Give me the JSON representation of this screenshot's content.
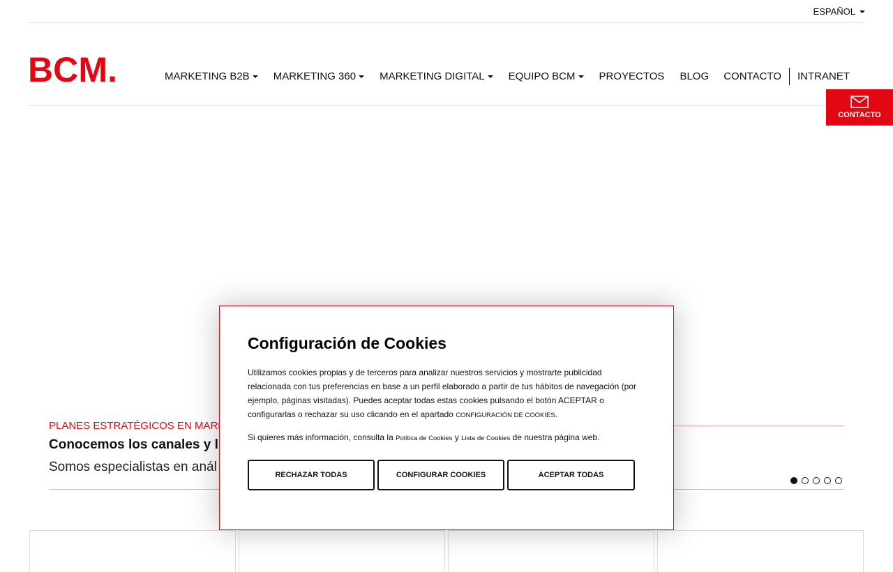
{
  "topbar": {
    "language": "ESPAÑOL"
  },
  "header": {
    "logo_text": "BCM.",
    "nav": [
      {
        "label": "MARKETING B2B",
        "dropdown": true
      },
      {
        "label": "MARKETING 360",
        "dropdown": true
      },
      {
        "label": "MARKETING DIGITAL",
        "dropdown": true
      },
      {
        "label": "EQUIPO BCM",
        "dropdown": true
      },
      {
        "label": "PROYECTOS",
        "dropdown": false
      },
      {
        "label": "BLOG",
        "dropdown": false
      }
    ],
    "right_nav": [
      {
        "label": "CONTACTO"
      },
      {
        "label": "INTRANET"
      }
    ]
  },
  "side_contact": {
    "label": "CONTACTO",
    "icon": "envelope-icon"
  },
  "hero": {
    "label": "PLANES ESTRATÉGICOS EN MARKE",
    "title": "Conocemos los canales y l",
    "subtitle": "Somos especialistas en anál",
    "slides_total": 5,
    "active_slide": 1
  },
  "cookie_modal": {
    "title": "Configuración de Cookies",
    "body": "Utilizamos cookies propias y de terceros para analizar nuestros servicios y mostrarte publicidad relacionada con tus preferencias en base a un perfil elaborado a partir de tus hábitos de navegación (por ejemplo, páginas visitadas). Puedes aceptar todas estas cookies pulsando el botón ACEPTAR o configurarlas o rechazar su uso clicando en el apartado ",
    "config_link": "CONFIGURACIÓN DE COOKIES",
    "info_prefix": "Si quieres más información, consulta la ",
    "policy_link": "Política de Cookies",
    "and": " y ",
    "list_link": "Lista de Cookies",
    "info_suffix": " de nuestra página web.",
    "buttons": {
      "reject": "RECHAZAR TODAS",
      "configure": "CONFIGURAR COOKIES",
      "accept": "ACEPTAR TODAS"
    }
  },
  "colors": {
    "brand_red": "#e30613",
    "divider_pink": "#f2a6a6"
  }
}
